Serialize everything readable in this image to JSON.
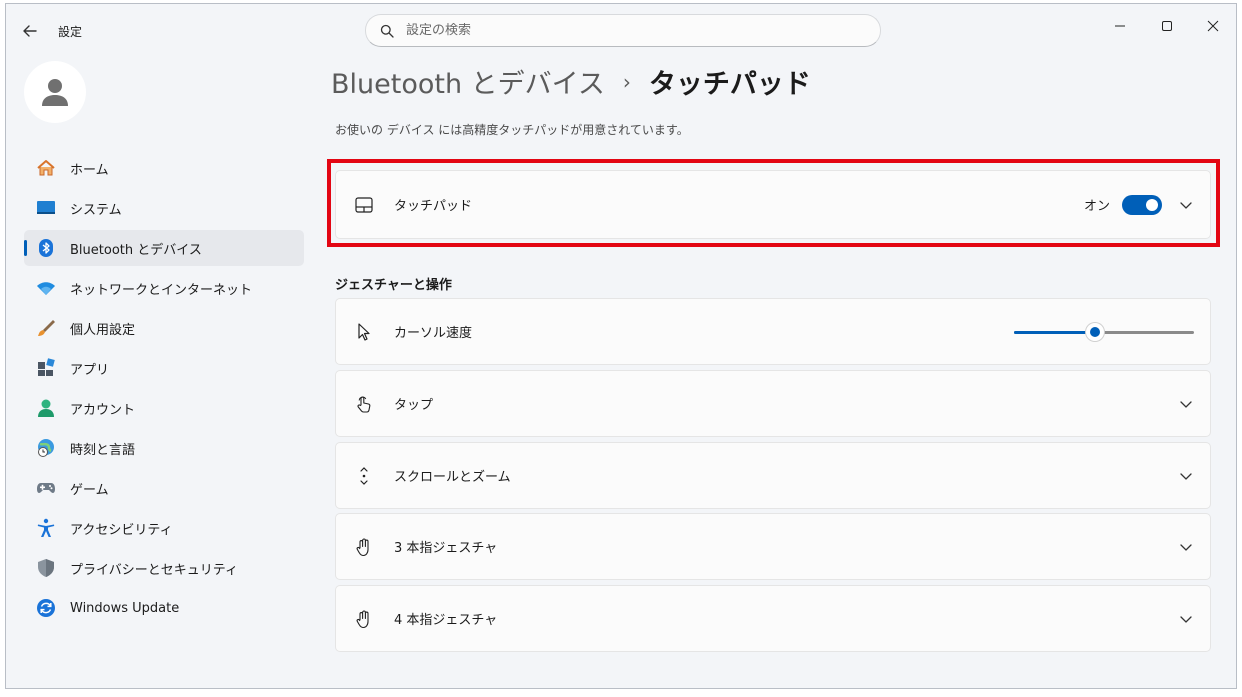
{
  "window": {
    "title": "設定"
  },
  "search": {
    "placeholder": "設定の検索"
  },
  "sidebar": {
    "items": [
      {
        "label": "ホーム",
        "icon": "home-icon"
      },
      {
        "label": "システム",
        "icon": "system-icon"
      },
      {
        "label": "Bluetooth とデバイス",
        "icon": "bluetooth-icon",
        "active": true
      },
      {
        "label": "ネットワークとインターネット",
        "icon": "wifi-icon"
      },
      {
        "label": "個人用設定",
        "icon": "brush-icon"
      },
      {
        "label": "アプリ",
        "icon": "apps-icon"
      },
      {
        "label": "アカウント",
        "icon": "account-icon"
      },
      {
        "label": "時刻と言語",
        "icon": "globe-clock-icon"
      },
      {
        "label": "ゲーム",
        "icon": "gamepad-icon"
      },
      {
        "label": "アクセシビリティ",
        "icon": "accessibility-icon"
      },
      {
        "label": "プライバシーとセキュリティ",
        "icon": "shield-icon"
      },
      {
        "label": "Windows Update",
        "icon": "update-icon"
      }
    ]
  },
  "breadcrumb": {
    "parent": "Bluetooth とデバイス",
    "separator": "›",
    "current": "タッチパッド"
  },
  "subtitle": "お使いの デバイス には高精度タッチパッドが用意されています。",
  "touchpad_card": {
    "label": "タッチパッド",
    "toggle_state": "オン",
    "toggle_on": true
  },
  "gestures": {
    "section_title": "ジェスチャーと操作",
    "cursor_speed": {
      "label": "カーソル速度",
      "value_fraction": 0.45
    },
    "items": [
      {
        "label": "タップ",
        "icon": "tap-icon"
      },
      {
        "label": "スクロールとズーム",
        "icon": "scroll-icon"
      },
      {
        "label": "3 本指ジェスチャ",
        "icon": "hand-icon"
      },
      {
        "label": "4 本指ジェスチャ",
        "icon": "hand-icon"
      }
    ]
  },
  "colors": {
    "accent": "#005fb8",
    "highlight": "#e30613",
    "background": "#f3f5f8",
    "card": "#fbfbfb"
  }
}
